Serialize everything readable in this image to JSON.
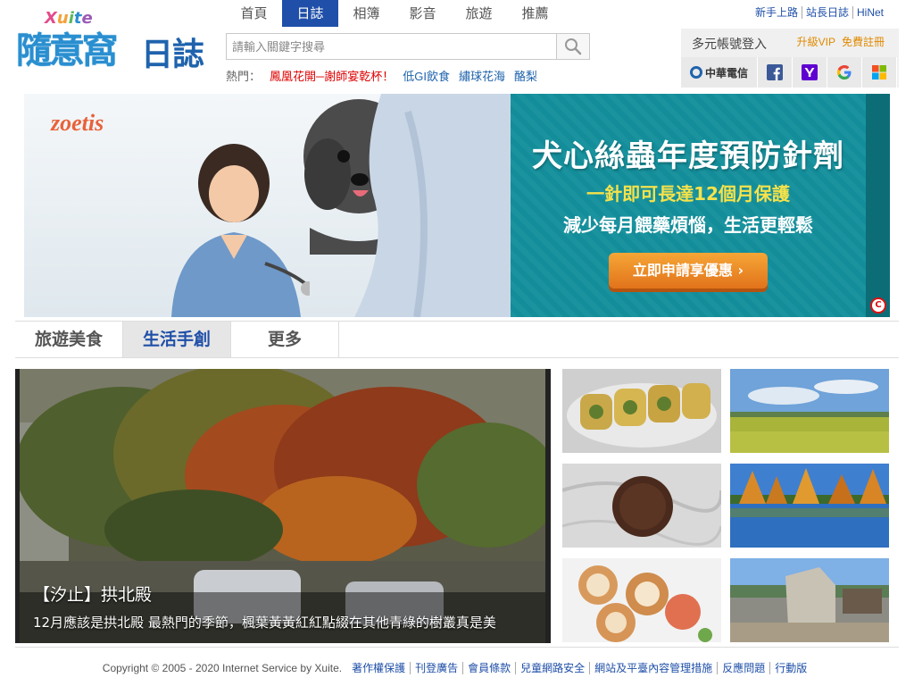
{
  "logo": {
    "xuite": "Xuite",
    "brand_a": "隨意窩",
    "brand_b": "日誌"
  },
  "nav": {
    "tabs": [
      "首頁",
      "日誌",
      "相簿",
      "影音",
      "旅遊",
      "推薦"
    ],
    "active_index": 1
  },
  "search": {
    "placeholder": "請輸入關鍵字搜尋",
    "value": ""
  },
  "hot": {
    "label": "熱門：",
    "items": [
      "鳳凰花開─謝師宴乾杯！",
      "低GI飲食",
      "繡球花海",
      "酪梨"
    ]
  },
  "toplinks": [
    "新手上路",
    "站長日誌",
    "HiNet"
  ],
  "login": {
    "title": "多元帳號登入",
    "vip": "升級VIP",
    "register": "免費註冊",
    "providers": [
      "中華電信",
      "facebook-icon",
      "yahoo-icon",
      "google-icon",
      "microsoft-icon"
    ]
  },
  "banner": {
    "brand": "zoetis",
    "headline": "犬心絲蟲年度預防針劑",
    "subline": "一針即可長達12個月保護",
    "line3": "減少每月餵藥煩惱，生活更輕鬆",
    "cta": "立即申請享優惠 ›"
  },
  "categories": {
    "tabs": [
      "旅遊美食",
      "生活手創",
      "更多"
    ],
    "active_index": 1
  },
  "featured": {
    "title": "【汐止】拱北殿",
    "desc": "12月應該是拱北殿 最熱門的季節，楓葉黃黃紅紅點綴在其他青綠的樹叢真是美"
  },
  "footer": {
    "copyright": "Copyright © 2005 - 2020 Internet Service by Xuite.",
    "links": [
      "著作權保護",
      "刊登廣告",
      "會員條款",
      "兒童網路安全",
      "網站及平臺內容管理措施",
      "反應問題",
      "行動版"
    ]
  },
  "colors": {
    "nav_active": "#1f4fa8",
    "hot_red": "#dd0000",
    "link_blue": "#1f63ad",
    "vip_orange": "#e08a00",
    "banner_teal": "#13909c"
  }
}
